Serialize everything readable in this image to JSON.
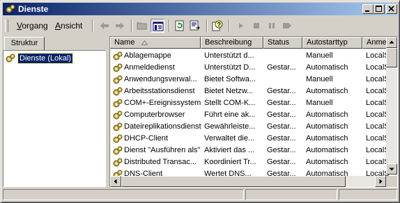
{
  "window": {
    "title": "Dienste"
  },
  "menu": {
    "vorgang": "Vorgang",
    "ansicht": "Ansicht"
  },
  "left_panel": {
    "tab": "Struktur",
    "tree_root": "Dienste (Lokal)"
  },
  "columns": [
    "Name",
    "Beschreibung",
    "Status",
    "Autostarttyp",
    "Anme"
  ],
  "rows": [
    {
      "name": "Ablagemappe",
      "desc": "Unterstützt d...",
      "status": "",
      "start": "Manuell",
      "logon": "LocalS"
    },
    {
      "name": "Anmeldedienst",
      "desc": "Unterstützt D...",
      "status": "Gestar...",
      "start": "Automatisch",
      "logon": "LocalS"
    },
    {
      "name": "Anwendungsverwal...",
      "desc": "Bietet Softwa...",
      "status": "",
      "start": "Manuell",
      "logon": "LocalS"
    },
    {
      "name": "Arbeitsstationsdienst",
      "desc": "Bietet Netzw...",
      "status": "Gestar...",
      "start": "Automatisch",
      "logon": "LocalS"
    },
    {
      "name": "COM+-Ereignissystem",
      "desc": "Stellt COM-K...",
      "status": "Gestar...",
      "start": "Manuell",
      "logon": "LocalS"
    },
    {
      "name": "Computerbrowser",
      "desc": "Führt eine ak...",
      "status": "Gestar...",
      "start": "Automatisch",
      "logon": "LocalS"
    },
    {
      "name": "Dateireplikationsdienst",
      "desc": "Gewährleiste...",
      "status": "Gestar...",
      "start": "Automatisch",
      "logon": "LocalS"
    },
    {
      "name": "DHCP-Client",
      "desc": "Verwaltet die...",
      "status": "Gestar...",
      "start": "Automatisch",
      "logon": "LocalS"
    },
    {
      "name": "Dienst \"Ausführen als\"",
      "desc": "Aktiviert das ...",
      "status": "Gestar...",
      "start": "Automatisch",
      "logon": "LocalS"
    },
    {
      "name": "Distributed Transac...",
      "desc": "Koordiniert Tr...",
      "status": "Gestar...",
      "start": "Automatisch",
      "logon": "LocalS"
    },
    {
      "name": "DNS-Client",
      "desc": "Wertet DNS...",
      "status": "Gestar...",
      "start": "Automatisch",
      "logon": "LocalS"
    }
  ],
  "colors": {
    "title_start": "#0a246a",
    "title_end": "#a6caf0",
    "face": "#d4d0c8",
    "selection": "#0a246a"
  }
}
